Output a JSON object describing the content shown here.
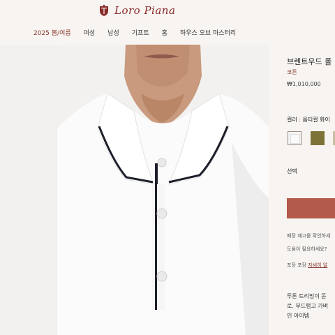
{
  "brand": {
    "name": "Loro Piana"
  },
  "nav": {
    "items": [
      {
        "label": "2025 봄/여름"
      },
      {
        "label": "여성"
      },
      {
        "label": "남성"
      },
      {
        "label": "기프트"
      },
      {
        "label": "홈"
      },
      {
        "label": "하우스 오브 마스터리"
      }
    ]
  },
  "product": {
    "title": "브렌트우드 폴",
    "material": "코튼",
    "price": "₩1,010,000",
    "color_label": "컬러 : 옵티컬 화이",
    "swatches": [
      {
        "name": "optical-white",
        "color": "#f5f5f5"
      },
      {
        "name": "olive",
        "color": "#7d7337"
      },
      {
        "name": "beige",
        "color": "#c8bea0"
      }
    ],
    "size_label": "선택",
    "add_button_color": "#b35a4a",
    "stock_text": "매장 재고를 확인하세",
    "help_text": "도움이 필요하세요?",
    "packaging_label": "포장 포장",
    "packaging_link": "자세히 알",
    "description_lines": [
      "투톤 트리밍이 돋",
      "로. 부드럽고 가벼",
      "인 아이템"
    ]
  }
}
